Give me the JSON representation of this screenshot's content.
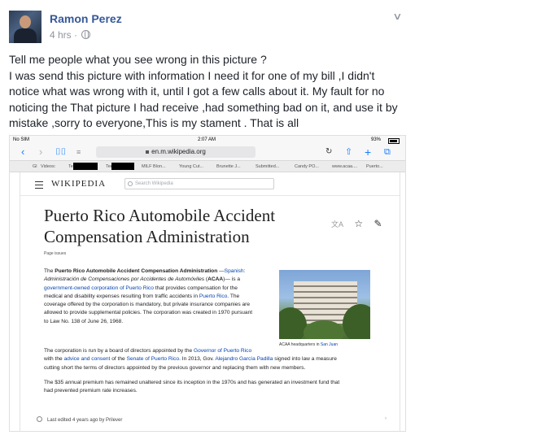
{
  "post": {
    "author": "Ramon Perez",
    "time": "4 hrs",
    "text": "Tell me people what you see wrong in this picture ?\nI was send this picture with information I need it for one of my bill ,I didn't notice what was wrong with it, until I got a few calls about it. My fault for no noticing the That picture I had receive ,had something bad on it, and use it by mistake ,sorry to everyone,This is my stament . That is all"
  },
  "shot": {
    "status": {
      "carrier": "No SIM",
      "time": "2:07 AM",
      "battery": "93%"
    },
    "url": "en.m.wikipedia.org",
    "bookmarks": [
      "Videos:",
      "MILF Blon...",
      "Young Cut...",
      "Brunette J...",
      "Submitted...",
      "Candy PO...",
      "www.acaa....",
      "Puerto..."
    ],
    "bookmark_prefix": "Gl",
    "redact_labels": [
      "Te",
      "Tee"
    ],
    "wiki": {
      "logo": "WIKIPEDIA",
      "search_placeholder": "Search Wikipedia",
      "title": "Puerto Rico Automobile Accident Compensation Administration",
      "page_issues": "Page issues",
      "caption_pre": "ACAA headquarters in ",
      "caption_link": "San Juan",
      "edited": "Last edited 4 years ago by Prilever"
    }
  },
  "icons": {
    "back": "chevron-left-icon",
    "forward": "chevron-right-icon",
    "bookmarks": "book-icon",
    "reader": "reader-icon",
    "reload": "reload-icon",
    "share": "share-icon",
    "add": "plus-icon",
    "tabs": "tabs-icon"
  }
}
